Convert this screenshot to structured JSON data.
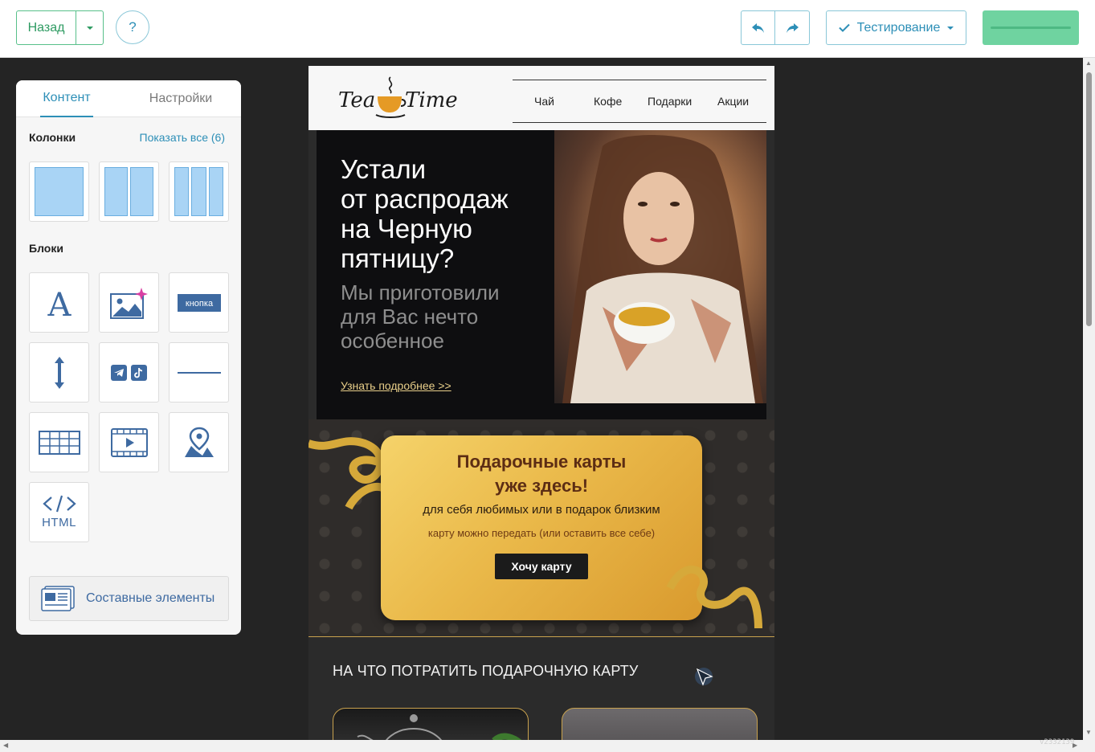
{
  "toolbar": {
    "back_label": "Назад",
    "help_label": "?",
    "test_label": "Тестирование",
    "colors": {
      "accent": "#2d8fb7",
      "success": "#58c08a",
      "save_fill": "#6fd3a0"
    }
  },
  "panel": {
    "tabs": [
      {
        "label": "Контент"
      },
      {
        "label": "Настройки"
      }
    ],
    "columns_title": "Колонки",
    "show_all": "Показать все (6)",
    "blocks_title": "Блоки",
    "button_block_label": "кнопка",
    "html_label": "HTML",
    "composite_label": "Составные элементы"
  },
  "email": {
    "logo": {
      "left": "Tea",
      "right": "Time"
    },
    "nav": [
      "Чай",
      "Кофе",
      "Подарки",
      "Акции"
    ],
    "hero": {
      "title_lines": [
        "Устали",
        "от распродаж",
        "на Черную",
        "пятницу?"
      ],
      "subtitle_lines": [
        "Мы приготовили",
        "для Вас нечто",
        "особенное"
      ],
      "link": "Узнать подробнее >>"
    },
    "gift": {
      "title_lines": [
        "Подарочные карты",
        "уже здесь!"
      ],
      "subtitle": "для себя любимых или в подарок близким",
      "note": "карту можно передать (или оставить все себе)",
      "button": "Хочу карту"
    },
    "spend_title": "НА ЧТО ПОТРАТИТЬ ПОДАРОЧНУЮ КАРТУ"
  },
  "version": "v2332139"
}
